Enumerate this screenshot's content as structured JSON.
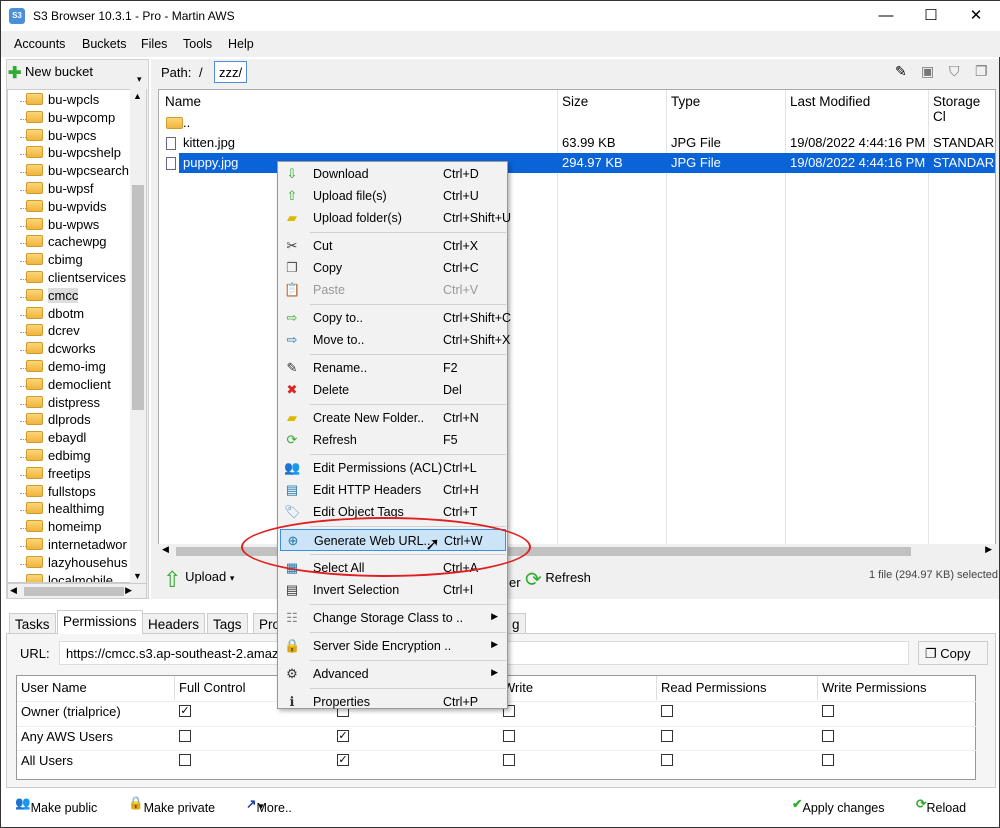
{
  "window": {
    "title": "S3 Browser 10.3.1 - Pro - Martin AWS",
    "icon_text": "S3"
  },
  "menu": [
    "Accounts",
    "Buckets",
    "Files",
    "Tools",
    "Help"
  ],
  "left": {
    "new_bucket": "New bucket",
    "buckets": [
      "bu-wpcls",
      "bu-wpcomp",
      "bu-wpcs",
      "bu-wpcshelp",
      "bu-wpcsearch",
      "bu-wpsf",
      "bu-wpvids",
      "bu-wpws",
      "cachewpg",
      "cbimg",
      "clientservices",
      "cmcc",
      "dbotm",
      "dcrev",
      "dcworks",
      "demo-img",
      "democlient",
      "distpress",
      "dlprods",
      "ebaydl",
      "edbimg",
      "freetips",
      "fullstops",
      "healthimg",
      "homeimp",
      "internetadwor",
      "lazyhousehus",
      "localmobile"
    ],
    "selected": "cmcc"
  },
  "path": {
    "label": "Path:",
    "root": "/",
    "current": "zzz/"
  },
  "files": {
    "columns": [
      "Name",
      "Size",
      "Type",
      "Last Modified",
      "Storage Cl"
    ],
    "rows": [
      {
        "name": "..",
        "size": "",
        "type": "",
        "modified": "",
        "storage": ""
      },
      {
        "name": "kitten.jpg",
        "size": "63.99 KB",
        "type": "JPG File",
        "modified": "19/08/2022 4:44:16 PM",
        "storage": "STANDARD"
      },
      {
        "name": "puppy.jpg",
        "size": "294.97 KB",
        "type": "JPG File",
        "modified": "19/08/2022 4:44:16 PM",
        "storage": "STANDARD",
        "selected": true
      }
    ]
  },
  "toolbar": {
    "upload": "Upload",
    "partial": "er",
    "refresh": "Refresh",
    "status": "1 file (294.97 KB) selected"
  },
  "context_menu": [
    {
      "label": "Download",
      "shortcut": "Ctrl+D",
      "icon": "download-icon"
    },
    {
      "label": "Upload file(s)",
      "shortcut": "Ctrl+U",
      "icon": "upload-icon"
    },
    {
      "label": "Upload folder(s)",
      "shortcut": "Ctrl+Shift+U",
      "icon": "upload-folder-icon"
    },
    {
      "sep": true
    },
    {
      "label": "Cut",
      "shortcut": "Ctrl+X",
      "icon": "scissors-icon"
    },
    {
      "label": "Copy",
      "shortcut": "Ctrl+C",
      "icon": "copy-icon"
    },
    {
      "label": "Paste",
      "shortcut": "Ctrl+V",
      "icon": "paste-icon",
      "disabled": true
    },
    {
      "sep": true
    },
    {
      "label": "Copy to..",
      "shortcut": "Ctrl+Shift+C",
      "icon": "copy-to-icon"
    },
    {
      "label": "Move to..",
      "shortcut": "Ctrl+Shift+X",
      "icon": "move-to-icon"
    },
    {
      "sep": true
    },
    {
      "label": "Rename..",
      "shortcut": "F2",
      "icon": "pencil-icon"
    },
    {
      "label": "Delete",
      "shortcut": "Del",
      "icon": "delete-icon"
    },
    {
      "sep": true
    },
    {
      "label": "Create New Folder..",
      "shortcut": "Ctrl+N",
      "icon": "new-folder-icon"
    },
    {
      "label": "Refresh",
      "shortcut": "F5",
      "icon": "refresh-icon"
    },
    {
      "sep": true
    },
    {
      "label": "Edit Permissions (ACL)",
      "shortcut": "Ctrl+L",
      "icon": "users-icon"
    },
    {
      "label": "Edit HTTP Headers",
      "shortcut": "Ctrl+H",
      "icon": "headers-icon"
    },
    {
      "label": "Edit Object Tags",
      "shortcut": "Ctrl+T",
      "icon": "tag-icon"
    },
    {
      "sep": true
    },
    {
      "label": "Generate Web URL..",
      "shortcut": "Ctrl+W",
      "icon": "link-icon",
      "highlighted": true
    },
    {
      "sep": true
    },
    {
      "label": "Select All",
      "shortcut": "Ctrl+A",
      "icon": "select-all-icon"
    },
    {
      "label": "Invert Selection",
      "shortcut": "Ctrl+I",
      "icon": "invert-icon"
    },
    {
      "sep": true
    },
    {
      "label": "Change Storage Class to ..",
      "submenu": true,
      "icon": "storage-icon"
    },
    {
      "sep": true
    },
    {
      "label": "Server Side Encryption ..",
      "submenu": true,
      "icon": "lock-icon"
    },
    {
      "sep": true
    },
    {
      "label": "Advanced",
      "submenu": true,
      "icon": "gear-icon"
    },
    {
      "sep": true
    },
    {
      "label": "Properties",
      "shortcut": "Ctrl+P",
      "icon": "info-icon"
    }
  ],
  "tabs": {
    "items": [
      "Tasks",
      "Permissions",
      "Headers",
      "Tags",
      "Pro"
    ],
    "active": "Permissions",
    "partial": "g"
  },
  "url": {
    "label": "URL:",
    "value": "https://cmcc.s3.ap-southeast-2.amaz",
    "copy": "Copy"
  },
  "permissions": {
    "columns": [
      "User Name",
      "Full Control",
      "",
      "Write",
      "Read Permissions",
      "Write Permissions"
    ],
    "rows": [
      {
        "user": "Owner (trialprice)",
        "checks": [
          true,
          false,
          false,
          false,
          false
        ]
      },
      {
        "user": "Any AWS Users",
        "checks": [
          false,
          true,
          false,
          false,
          false
        ]
      },
      {
        "user": "All Users",
        "checks": [
          false,
          true,
          false,
          false,
          false
        ]
      }
    ]
  },
  "bottom_toolbar": {
    "make_public": "Make public",
    "make_private": "Make private",
    "more": "More..",
    "apply": "Apply changes",
    "reload": "Reload"
  },
  "colors": {
    "selection": "#0a64d8",
    "highlight": "#cce4f7",
    "annotation": "#e02020"
  }
}
